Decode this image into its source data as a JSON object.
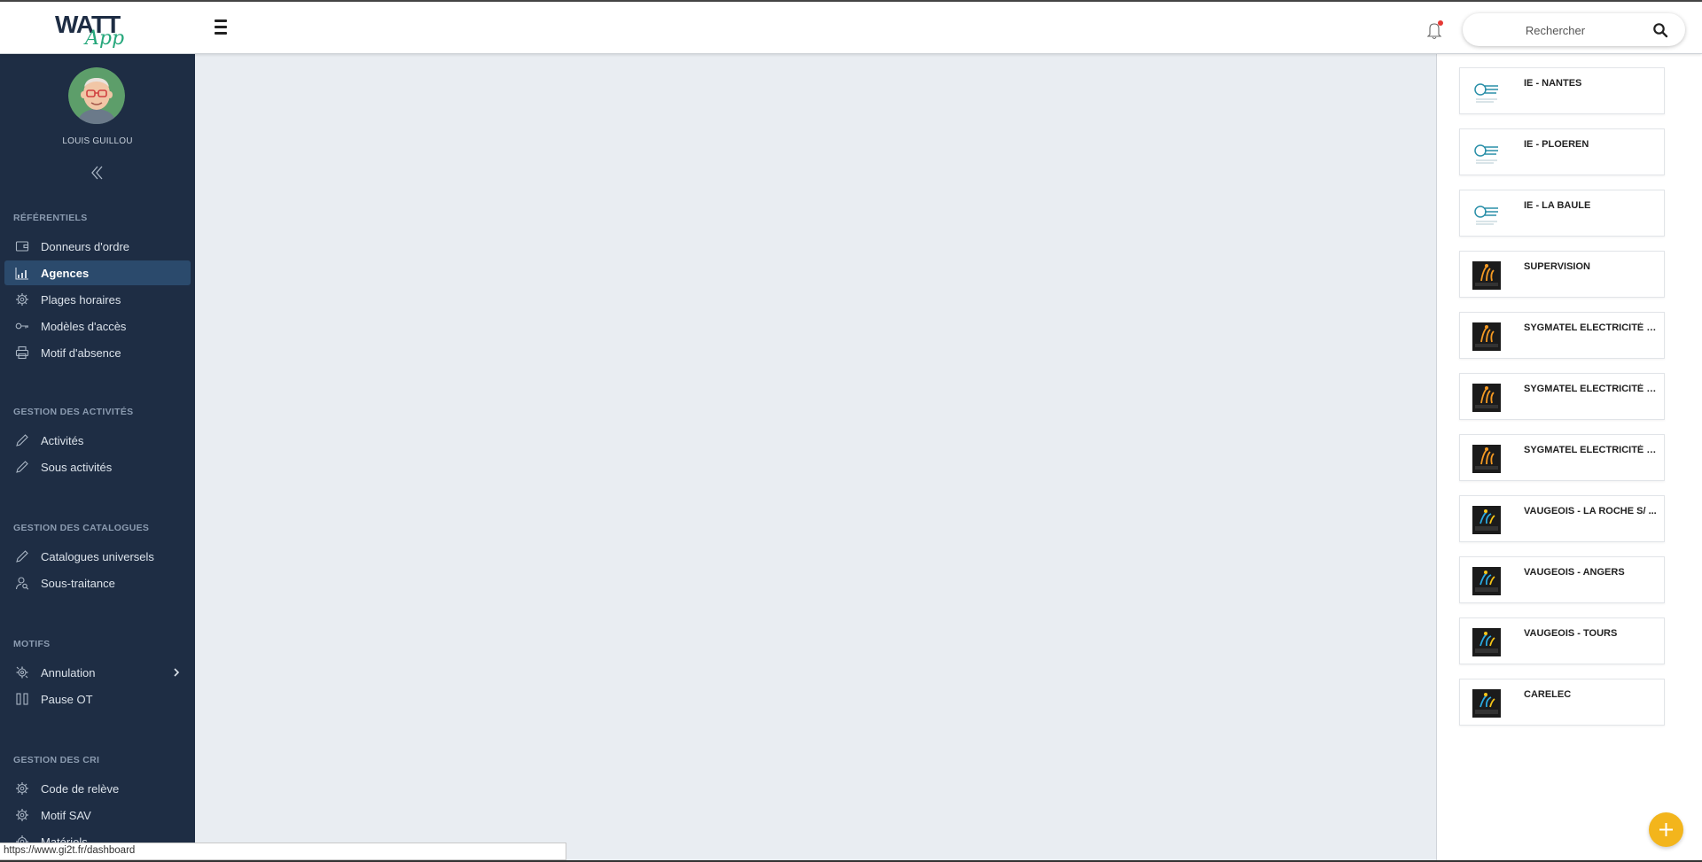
{
  "header": {
    "logo_text": "WATT",
    "logo_sub": "App",
    "search_placeholder": "Rechercher",
    "icons": {
      "menu": "hamburger-icon",
      "notification": "bell-icon",
      "search": "search-icon"
    }
  },
  "sidebar": {
    "user_name": "LOUIS GUILLOU",
    "sections": [
      {
        "title": "RÉFÉRENTIELS",
        "items": [
          {
            "label": "Donneurs d'ordre",
            "icon": "wallet-icon"
          },
          {
            "label": "Agences",
            "icon": "chart-icon",
            "active": true
          },
          {
            "label": "Plages horaires",
            "icon": "gear-icon"
          },
          {
            "label": "Modèles d'accès",
            "icon": "key-icon"
          },
          {
            "label": "Motif d'absence",
            "icon": "printer-icon"
          }
        ]
      },
      {
        "title": "GESTION DES ACTIVITÉS",
        "items": [
          {
            "label": "Activités",
            "icon": "pencil-icon"
          },
          {
            "label": "Sous activités",
            "icon": "pencil-icon"
          }
        ]
      },
      {
        "title": "GESTION DES CATALOGUES",
        "items": [
          {
            "label": "Catalogues universels",
            "icon": "pencil-icon"
          },
          {
            "label": "Sous-traitance",
            "icon": "user-search-icon"
          }
        ]
      },
      {
        "title": "MOTIFS",
        "items": [
          {
            "label": "Annulation",
            "icon": "gears-icon",
            "has_submenu": true
          },
          {
            "label": "Pause OT",
            "icon": "pause-icon"
          }
        ]
      },
      {
        "title": "GESTION DES CRI",
        "items": [
          {
            "label": "Code de relève",
            "icon": "gear-icon"
          },
          {
            "label": "Motif SAV",
            "icon": "gear-icon"
          },
          {
            "label": "Matériels",
            "icon": "gear-icon"
          }
        ]
      }
    ]
  },
  "agencies": [
    {
      "name": "IE - NANTES",
      "logo": "ie"
    },
    {
      "name": "IE - PLOEREN",
      "logo": "ie"
    },
    {
      "name": "IE - LA BAULE",
      "logo": "ie"
    },
    {
      "name": "SUPERVISION",
      "logo": "sygmatel"
    },
    {
      "name": "SYGMATEL ELECTRICITÉ - ...",
      "logo": "sygmatel"
    },
    {
      "name": "SYGMATEL ELECTRICITÉ - ...",
      "logo": "sygmatel"
    },
    {
      "name": "SYGMATEL ELECTRICITÉ - ...",
      "logo": "sygmatel"
    },
    {
      "name": "VAUGEOIS - LA ROCHE S/ ...",
      "logo": "vaugeois"
    },
    {
      "name": "VAUGEOIS - ANGERS",
      "logo": "vaugeois"
    },
    {
      "name": "VAUGEOIS - TOURS",
      "logo": "vaugeois"
    },
    {
      "name": "CARELEC",
      "logo": "carelec"
    }
  ],
  "status_url": "https://www.gi2t.fr/dashboard",
  "colors": {
    "sidebar_bg": "#1e2d44",
    "active_item": "#2b4a6c",
    "main_bg": "#e9edf2",
    "accent_fab": "#f3b51c",
    "logo_green": "#25a77b"
  }
}
